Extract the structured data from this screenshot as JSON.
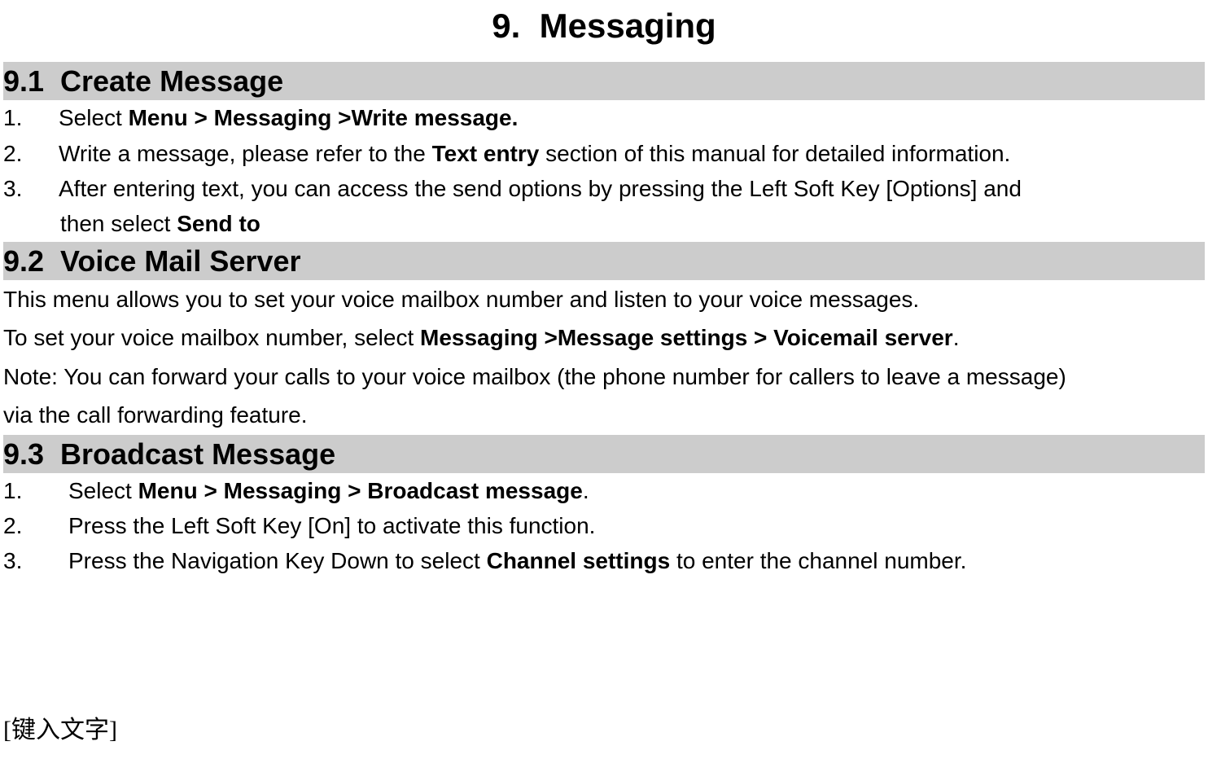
{
  "chapter": {
    "number": "9.",
    "title": "Messaging"
  },
  "sections": [
    {
      "num": "9.1",
      "title": "Create Message",
      "steps": [
        {
          "n": "1.",
          "pre": "Select ",
          "bold": "Menu > Messaging >Write message.",
          "post": ""
        },
        {
          "n": "2.",
          "pre": "Write a message, please refer to the ",
          "bold": "Text entry",
          "post": " section of this manual for detailed information."
        },
        {
          "n": "3.",
          "pre": "After entering text, you can access the send options by pressing the Left Soft Key [Options] and",
          "bold": "",
          "post": ""
        }
      ],
      "step3_cont_pre": "then select ",
      "step3_cont_bold": "Send to"
    },
    {
      "num": "9.2",
      "title": "Voice Mail Server",
      "paras": [
        {
          "pre": "This menu allows you to set your voice mailbox number and listen to your voice messages.",
          "bold": "",
          "post": ""
        },
        {
          "pre": "To set your voice mailbox number, select ",
          "bold": "Messaging >Message settings > Voicemail server",
          "post": "."
        },
        {
          "pre": "Note: You can forward your calls to your voice mailbox (the phone number for callers to leave a message)",
          "bold": "",
          "post": ""
        },
        {
          "pre": "via the call forwarding feature.",
          "bold": "",
          "post": ""
        }
      ]
    },
    {
      "num": "9.3",
      "title": "Broadcast Message",
      "steps": [
        {
          "n": "1.",
          "pre": "Select ",
          "bold": "Menu > Messaging > Broadcast message",
          "post": "."
        },
        {
          "n": "2.",
          "pre": "Press the Left Soft Key [On] to activate this function.",
          "bold": "",
          "post": ""
        },
        {
          "n": "3.",
          "pre": "Press the Navigation Key Down to select ",
          "bold": "Channel settings",
          "post": " to enter the channel number."
        }
      ]
    }
  ],
  "footer": "[键入文字]"
}
